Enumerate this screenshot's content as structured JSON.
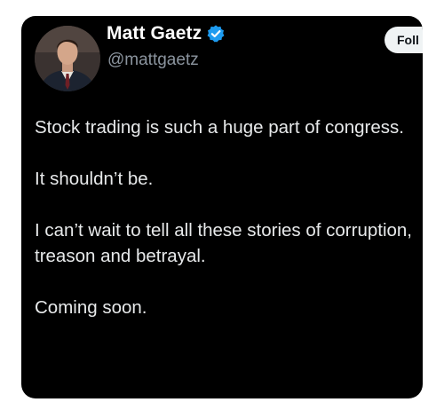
{
  "author": {
    "display_name": "Matt Gaetz",
    "handle": "@mattgaetz",
    "verified_icon": "verified-badge-icon",
    "verified_color": "#1d9bf0"
  },
  "follow_button": {
    "label": "Foll"
  },
  "tweet": {
    "paragraphs": [
      "Stock trading is such a huge part of congress.",
      "It shouldn’t be.",
      "I can’t wait to tell all these stories of corruption, treason and betrayal.",
      "Coming soon."
    ]
  },
  "colors": {
    "card_background": "#000000",
    "text_primary": "#e7e9ea",
    "text_secondary": "#8b949e",
    "page_background": "#ffffff"
  }
}
